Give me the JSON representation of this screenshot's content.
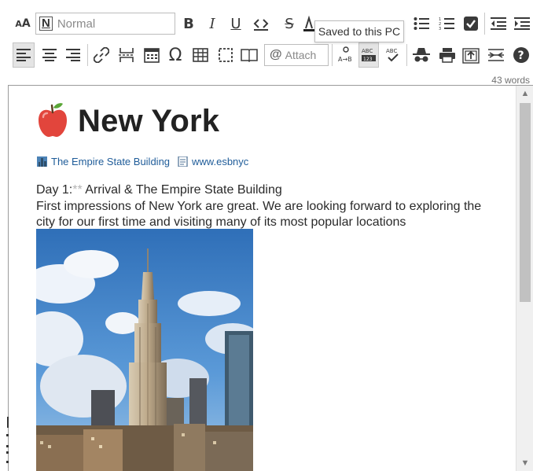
{
  "toolbar": {
    "style_select": {
      "prefix": "N",
      "value": "Normal"
    },
    "tooltip": "Saved to this PC",
    "attach_label": "Attach",
    "word_count": "43 words",
    "icons": [
      "font-size-icon",
      "bold-icon",
      "italic-icon",
      "underline-icon",
      "code-icon",
      "strikethrough-icon",
      "text-color-icon",
      "bullet-list-icon",
      "numbered-list-icon",
      "checkbox-icon",
      "outdent-icon",
      "indent-icon",
      "align-left-icon",
      "align-center-icon",
      "align-right-icon",
      "link-icon",
      "page-break-icon",
      "calendar-icon",
      "omega-icon",
      "table-icon",
      "selection-icon",
      "book-icon",
      "paperclip-icon",
      "find-replace-icon",
      "spellcheck-icon",
      "spell-correct-icon",
      "incognito-icon",
      "print-icon",
      "export-icon",
      "collapse-icon",
      "help-icon"
    ]
  },
  "document": {
    "title": "New York",
    "title_emoji": "apple",
    "link1": "The Empire State Building",
    "link2": "www.esbnyc",
    "day_prefix": "Day 1:",
    "day_stars": "**",
    "day_title": " Arrival & The Empire State Building",
    "paragraph": "First impressions of New York are great. We are looking forward to exploring the city for our first time and visiting many of its most popular locations",
    "image_desc": "empire-state-building-photo"
  },
  "colors": {
    "link": "#1f5c99",
    "text": "#2a2a2a",
    "apple": "#e2453c"
  }
}
